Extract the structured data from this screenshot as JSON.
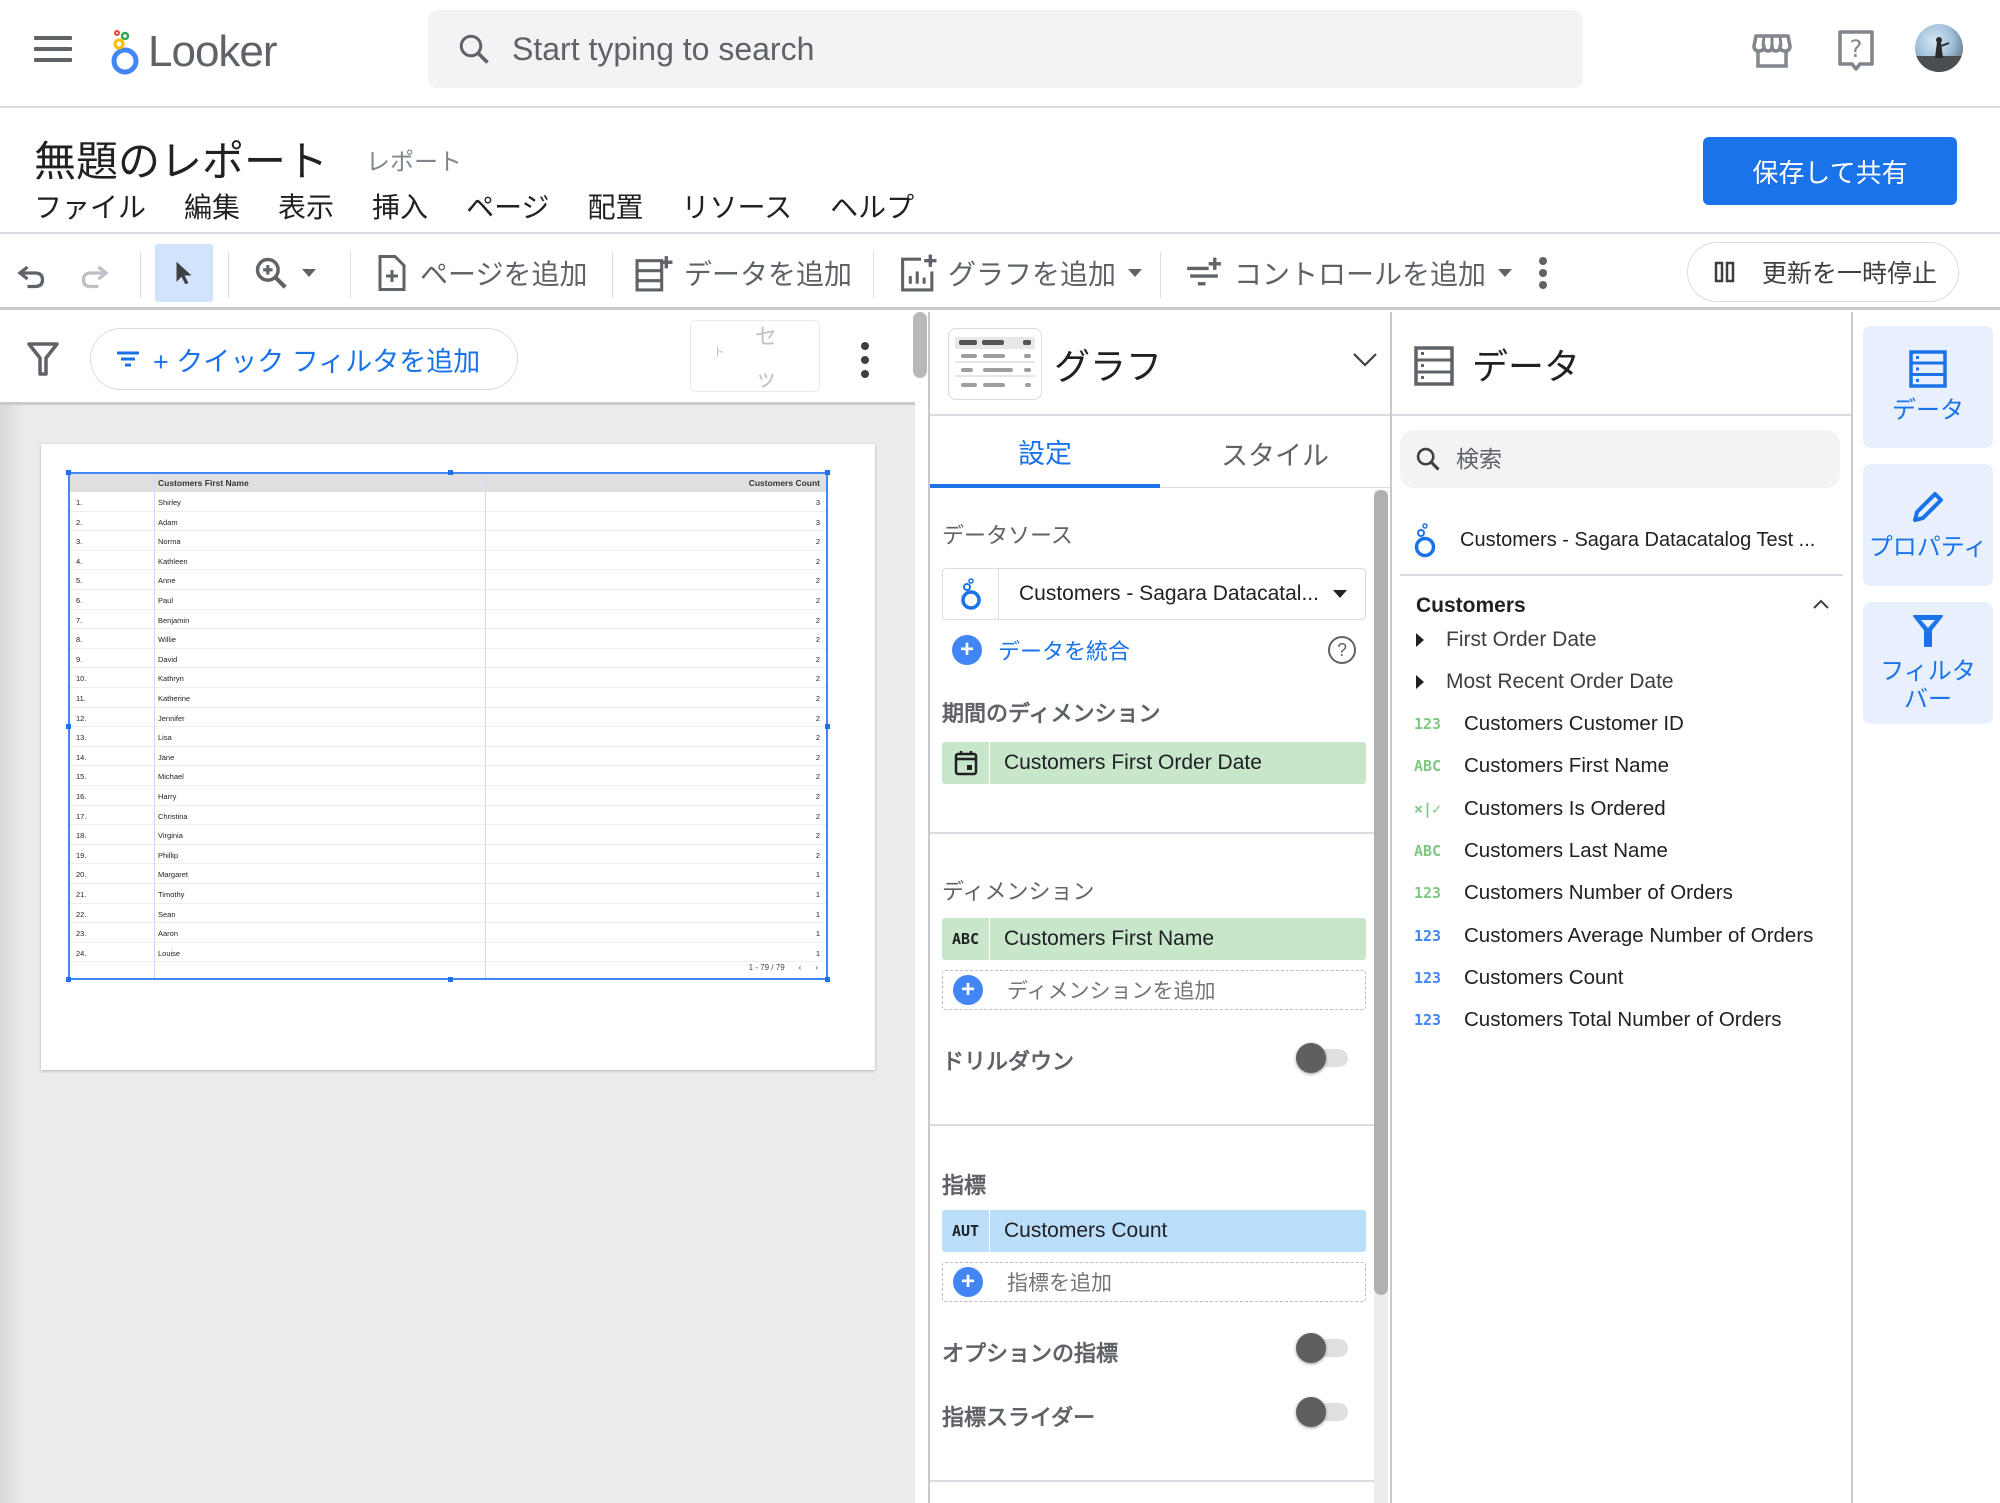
{
  "header": {
    "app_name": "Looker",
    "search_placeholder": "Start typing to search",
    "icons": [
      "menu-icon",
      "looker-logo-icon",
      "search-icon",
      "marketplace-icon",
      "help-icon",
      "avatar"
    ]
  },
  "report": {
    "title": "無題のレポート",
    "badge": "レポート",
    "save_share_label": "保存して共有"
  },
  "menu": [
    {
      "label": "ファイル"
    },
    {
      "label": "編集"
    },
    {
      "label": "表示"
    },
    {
      "label": "挿入"
    },
    {
      "label": "ページ"
    },
    {
      "label": "配置"
    },
    {
      "label": "リソース"
    },
    {
      "label": "ヘルプ"
    }
  ],
  "toolbar": {
    "add_page": "ページを追加",
    "add_data": "データを追加",
    "add_chart": "グラフを追加",
    "add_control": "コントロールを追加",
    "pause_updates": "更新を一時停止"
  },
  "canvas": {
    "quick_filter_label": "+ クイック フィルタを追加",
    "reset_label_top": "セ",
    "reset_label_left": "ト",
    "reset_label_bottom": "ッ"
  },
  "table": {
    "columns": [
      "",
      "Customers First Name",
      "Customers Count"
    ],
    "rows": [
      {
        "index": "1.",
        "name": "Shirley",
        "count": "3"
      },
      {
        "index": "2.",
        "name": "Adam",
        "count": "3"
      },
      {
        "index": "3.",
        "name": "Norma",
        "count": "2"
      },
      {
        "index": "4.",
        "name": "Kathleen",
        "count": "2"
      },
      {
        "index": "5.",
        "name": "Anne",
        "count": "2"
      },
      {
        "index": "6.",
        "name": "Paul",
        "count": "2"
      },
      {
        "index": "7.",
        "name": "Benjamin",
        "count": "2"
      },
      {
        "index": "8.",
        "name": "Willie",
        "count": "2"
      },
      {
        "index": "9.",
        "name": "David",
        "count": "2"
      },
      {
        "index": "10.",
        "name": "Kathryn",
        "count": "2"
      },
      {
        "index": "11.",
        "name": "Katherine",
        "count": "2"
      },
      {
        "index": "12.",
        "name": "Jennifer",
        "count": "2"
      },
      {
        "index": "13.",
        "name": "Lisa",
        "count": "2"
      },
      {
        "index": "14.",
        "name": "Jane",
        "count": "2"
      },
      {
        "index": "15.",
        "name": "Michael",
        "count": "2"
      },
      {
        "index": "16.",
        "name": "Harry",
        "count": "2"
      },
      {
        "index": "17.",
        "name": "Christina",
        "count": "2"
      },
      {
        "index": "18.",
        "name": "Virginia",
        "count": "2"
      },
      {
        "index": "19.",
        "name": "Phillip",
        "count": "2"
      },
      {
        "index": "20.",
        "name": "Margaret",
        "count": "1"
      },
      {
        "index": "21.",
        "name": "Timothy",
        "count": "1"
      },
      {
        "index": "22.",
        "name": "Sean",
        "count": "1"
      },
      {
        "index": "23.",
        "name": "Aaron",
        "count": "1"
      },
      {
        "index": "24.",
        "name": "Louise",
        "count": "1"
      }
    ],
    "pagination": "1 - 79 / 79"
  },
  "graph_panel": {
    "title": "グラフ",
    "tabs": [
      {
        "label": "設定",
        "active": true
      },
      {
        "label": "スタイル",
        "active": false
      }
    ],
    "data_source_label": "データソース",
    "data_source_value": "Customers - Sagara Datacatal...",
    "blend_label": "データを統合",
    "date_dimension_label": "期間のディメンション",
    "date_dimension_value": "Customers First Order Date",
    "dimension_label": "ディメンション",
    "dimension_type": "ABC",
    "dimension_value": "Customers First Name",
    "add_dimension": "ディメンションを追加",
    "drilldown_label": "ドリルダウン",
    "drilldown_on": false,
    "metric_label": "指標",
    "metric_type": "AUT",
    "metric_value": "Customers Count",
    "add_metric": "指標を追加",
    "optional_metrics_label": "オプションの指標",
    "optional_metrics_on": false,
    "metric_slider_label": "指標スライダー",
    "metric_slider_on": false
  },
  "data_panel": {
    "title": "データ",
    "search_placeholder": "検索",
    "source_name": "Customers - Sagara Datacatalog Test ...",
    "group_name": "Customers",
    "tree_items": [
      "First Order Date",
      "Most Recent Order Date"
    ],
    "fields": [
      {
        "type": "123",
        "kind": "dimension",
        "label": "Customers Customer ID"
      },
      {
        "type": "ABC",
        "kind": "dimension",
        "label": "Customers First Name"
      },
      {
        "type": "×|✓",
        "kind": "dimension",
        "label": "Customers Is Ordered"
      },
      {
        "type": "ABC",
        "kind": "dimension",
        "label": "Customers Last Name"
      },
      {
        "type": "123",
        "kind": "dimension",
        "label": "Customers Number of Orders"
      },
      {
        "type": "123",
        "kind": "metric",
        "label": "Customers Average Number of Orders"
      },
      {
        "type": "123",
        "kind": "metric",
        "label": "Customers Count"
      },
      {
        "type": "123",
        "kind": "metric",
        "label": "Customers Total Number of Orders"
      }
    ]
  },
  "right_rail": [
    {
      "label": "データ",
      "icon": "data-icon"
    },
    {
      "label": "プロパティ",
      "icon": "pencil-icon"
    },
    {
      "label": "フィルタバー",
      "icon": "filter-icon"
    }
  ],
  "colors": {
    "accent": "#1a73e8",
    "dimension_chip": "#c8e6c9",
    "metric_chip": "#bbdefb",
    "dimension_type": "#81c784",
    "metric_type": "#4285f4"
  }
}
